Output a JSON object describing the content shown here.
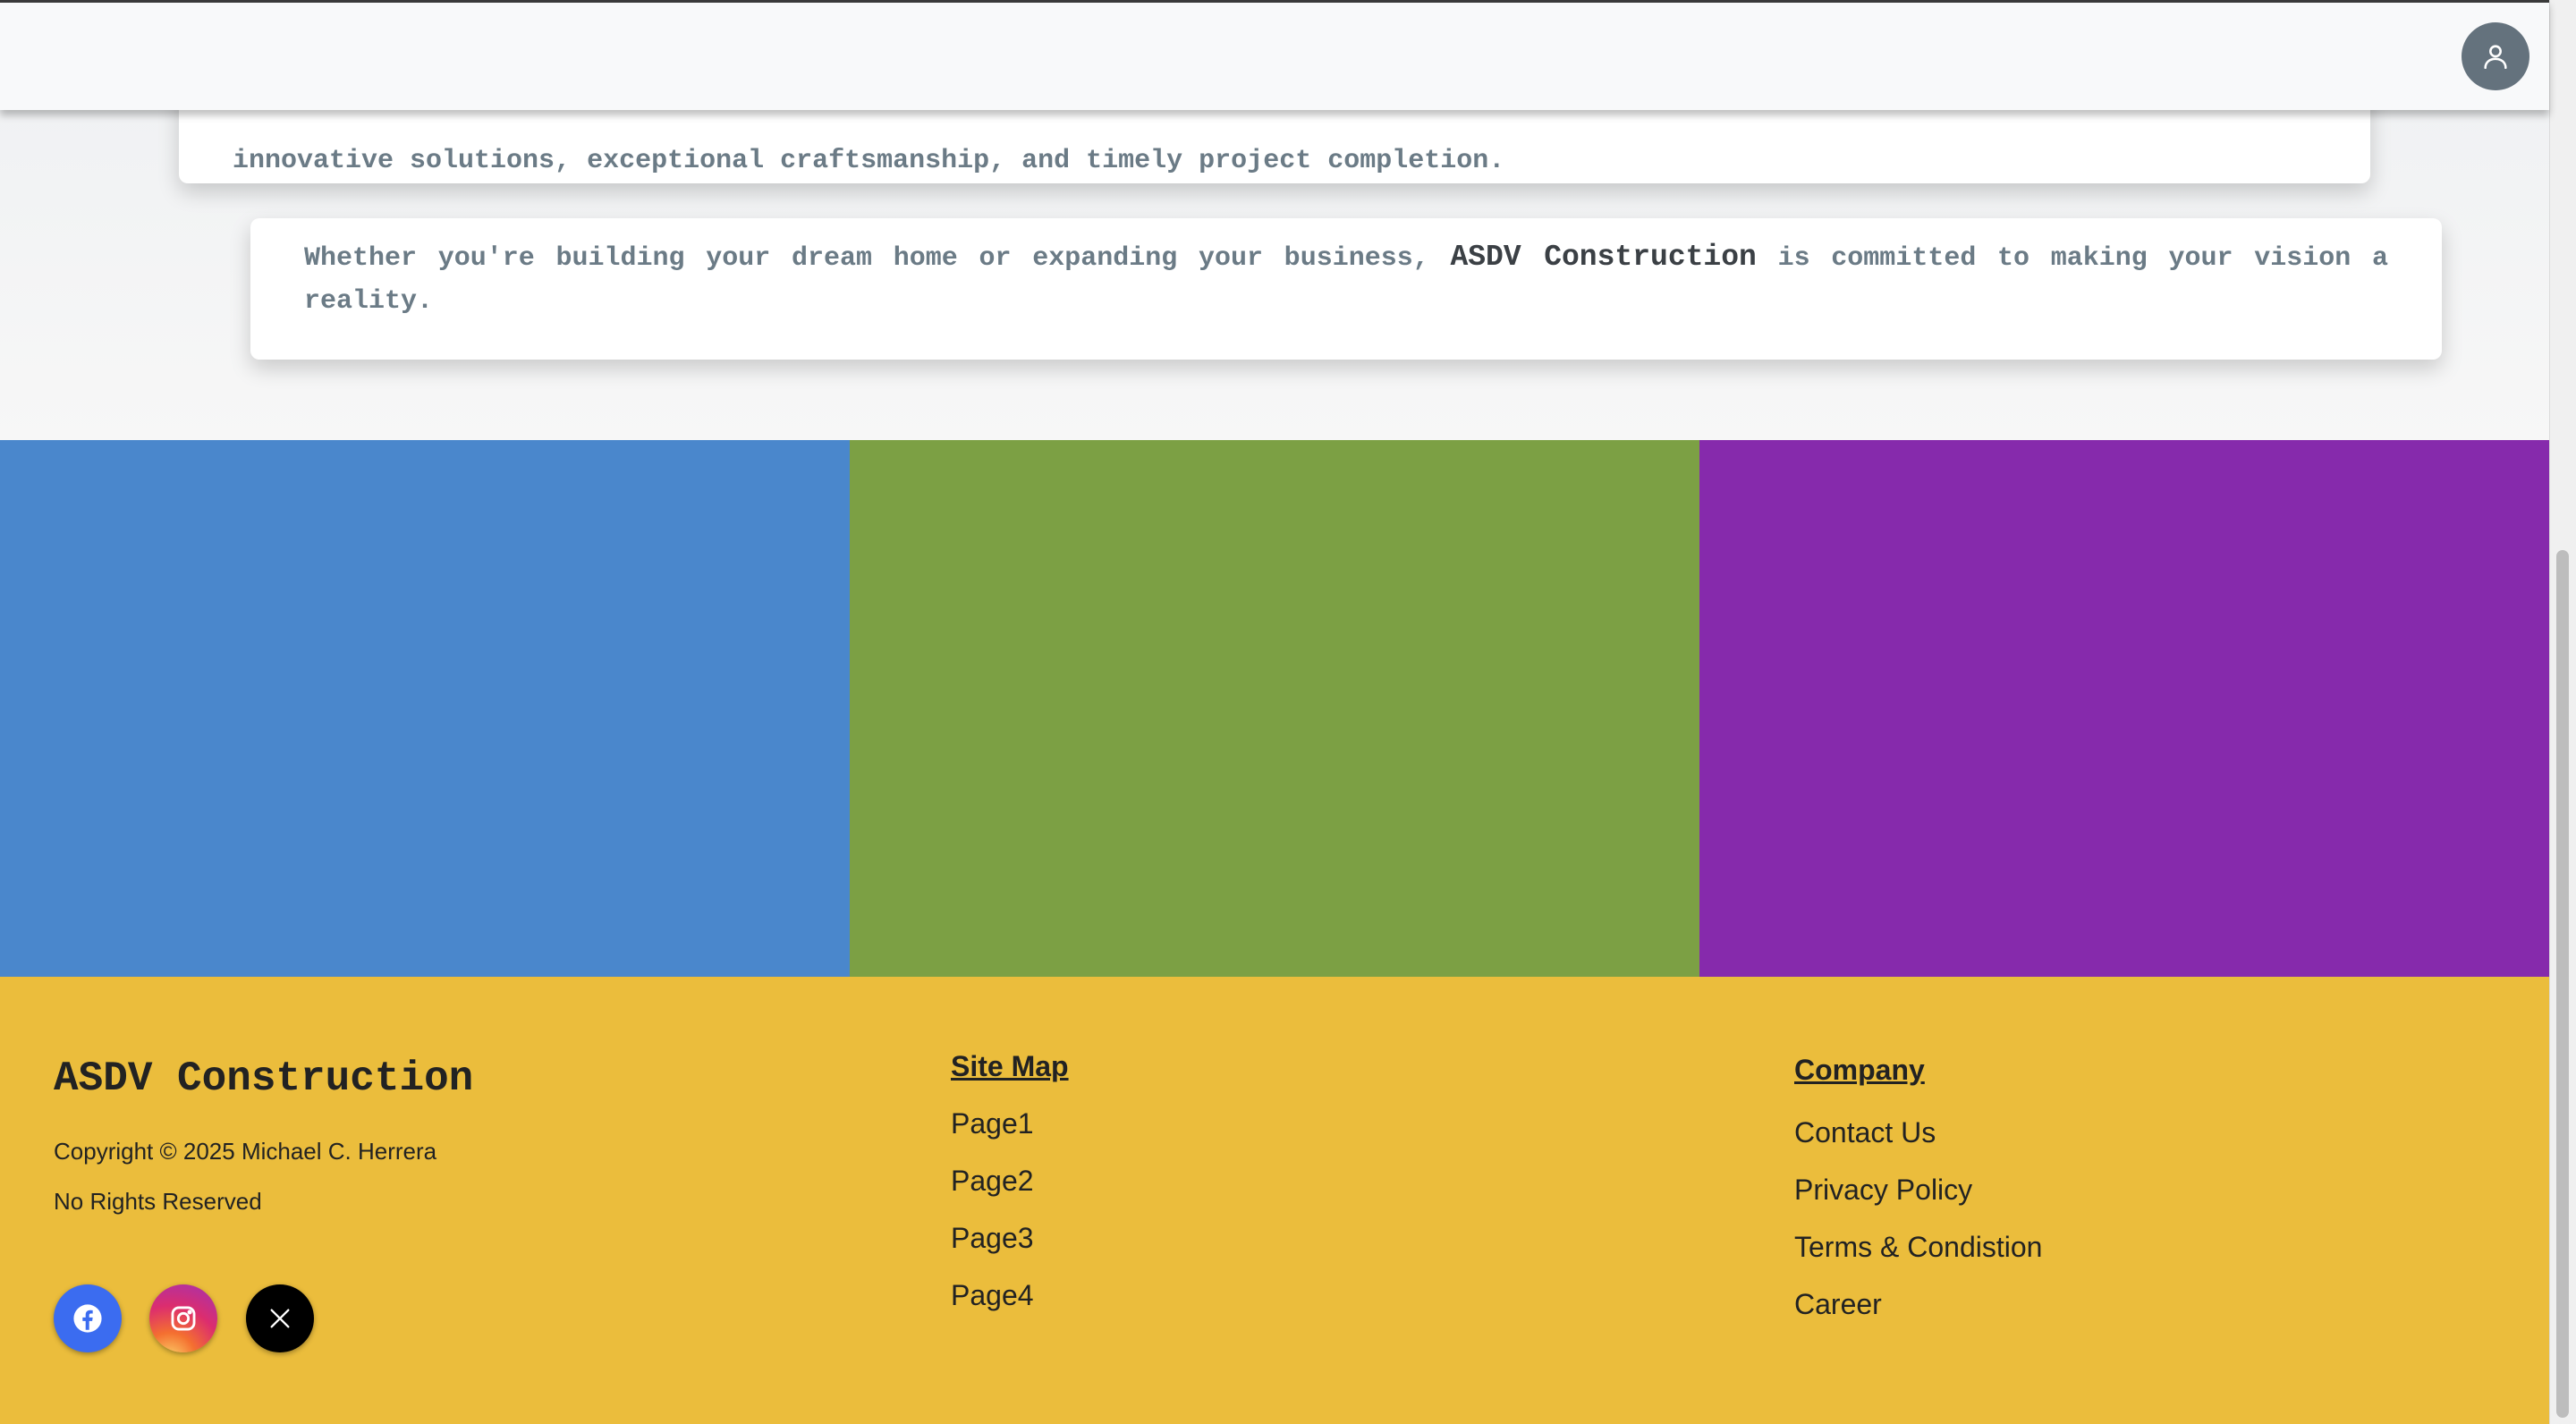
{
  "content": {
    "card1_text": "innovative solutions, exceptional craftsmanship, and timely project completion.",
    "card2_before": "Whether you're building your dream home or expanding your business, ",
    "card2_bold": "ASDV Construction",
    "card2_after": " is committed to making your vision a reality."
  },
  "panels": {
    "colors": [
      "#4a87cc",
      "#7ca044",
      "#862aac"
    ]
  },
  "footer": {
    "brand": "ASDV Construction",
    "copyright": "Copyright © 2025 Michael C. Herrera",
    "rights": "No Rights Reserved",
    "social": [
      "facebook-icon",
      "instagram-icon",
      "x-icon"
    ],
    "sitemap": {
      "heading": "Site Map",
      "links": [
        "Page1",
        "Page2",
        "Page3",
        "Page4"
      ]
    },
    "company": {
      "heading": "Company",
      "links": [
        "Contact Us",
        "Privacy Policy",
        "Terms & Condistion",
        "Career"
      ]
    },
    "background": "#ebbd3c"
  },
  "header": {
    "avatar_icon": "user-icon"
  }
}
